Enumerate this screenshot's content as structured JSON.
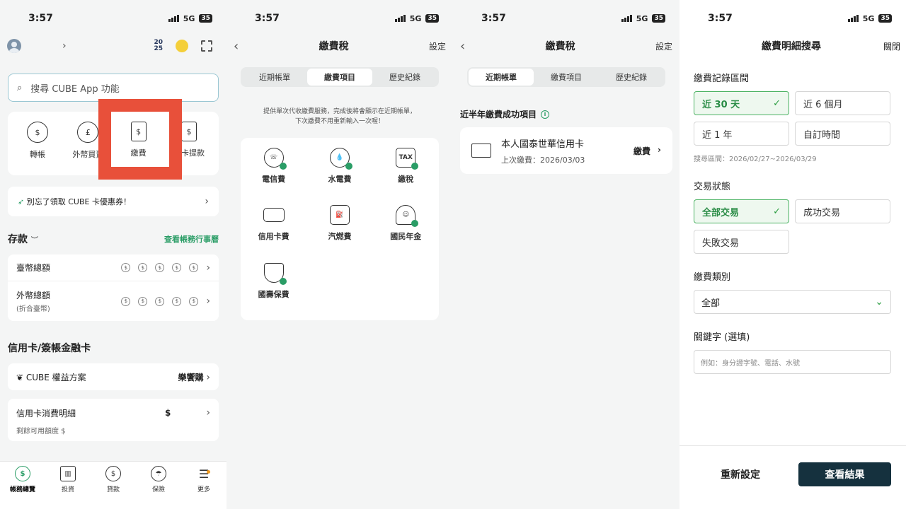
{
  "status": {
    "time": "3:57",
    "network": "5G",
    "battery": "35"
  },
  "screen1": {
    "year_badge_top": "20",
    "year_badge_bottom": "25",
    "search_placeholder": "搜尋 CUBE App 功能",
    "quick": [
      {
        "icon": "transfer-icon",
        "label": "轉帳"
      },
      {
        "icon": "fx-buy-icon",
        "label": "外幣買賣"
      },
      {
        "icon": "bill-doc-icon",
        "label": "繳費"
      },
      {
        "icon": "atm-withdraw-icon",
        "label": "無卡提款"
      }
    ],
    "promo_text": "別忘了領取 CUBE 卡優惠券！",
    "deposit_title": "存款",
    "deposit_link": "查看帳務行事曆",
    "twd_label": "臺幣總額",
    "fx_label": "外幣總額",
    "fx_sub": "(折合臺幣)",
    "credit_title": "信用卡/簽帳金融卡",
    "cube_plan": "CUBE 權益方案",
    "cube_plan_value": "樂饗購",
    "cc_detail": "信用卡消費明細",
    "cc_sub": "剩餘可用額度 $",
    "cc_value": "$",
    "tabs": [
      "帳務總覽",
      "投資",
      "貸款",
      "保險",
      "更多"
    ]
  },
  "screen2": {
    "title": "繳費稅",
    "settings": "設定",
    "segments": [
      "近期帳單",
      "繳費項目",
      "歷史紀錄"
    ],
    "note_line1": "提供單次代收繳費服務，完成後將會顯示在近期帳單，",
    "note_line2": "下次繳費不用重新輸入一次喔！",
    "items": [
      {
        "icon": "telecom-icon",
        "label": "電信費"
      },
      {
        "icon": "water-electric-icon",
        "label": "水電費"
      },
      {
        "icon": "tax-icon",
        "label": "繳稅"
      },
      {
        "icon": "credit-card-icon",
        "label": "信用卡費"
      },
      {
        "icon": "fuel-icon",
        "label": "汽燃費"
      },
      {
        "icon": "national-pension-icon",
        "label": "國民年金"
      },
      {
        "icon": "insurance-shield-icon",
        "label": "國壽保費"
      }
    ]
  },
  "screen3": {
    "title": "繳費稅",
    "settings": "設定",
    "segments": [
      "近期帳單",
      "繳費項目",
      "歷史紀錄"
    ],
    "section_label": "近半年繳費成功項目",
    "card_name": "本人國泰世華信用卡",
    "last_paid": "上次繳費：2026/03/03",
    "pay_label": "繳費"
  },
  "screen4": {
    "title": "繳費明細搜尋",
    "close": "關閉",
    "range_label": "繳費記錄區間",
    "range_opts": [
      "近 30 天",
      "近 6 個月",
      "近 1 年",
      "自訂時間"
    ],
    "range_hint": "搜尋區間：2026/02/27~2026/03/29",
    "status_label": "交易狀態",
    "status_opts": [
      "全部交易",
      "成功交易",
      "失敗交易"
    ],
    "category_label": "繳費類別",
    "category_value": "全部",
    "keyword_label": "關鍵字 (選填)",
    "keyword_placeholder": "例如：身分證字號、電話、水號",
    "reset": "重新設定",
    "submit": "查看結果"
  },
  "colors": {
    "accent_green": "#2a9d66",
    "highlight_red": "#e8503a",
    "primary_dark": "#15313e"
  }
}
